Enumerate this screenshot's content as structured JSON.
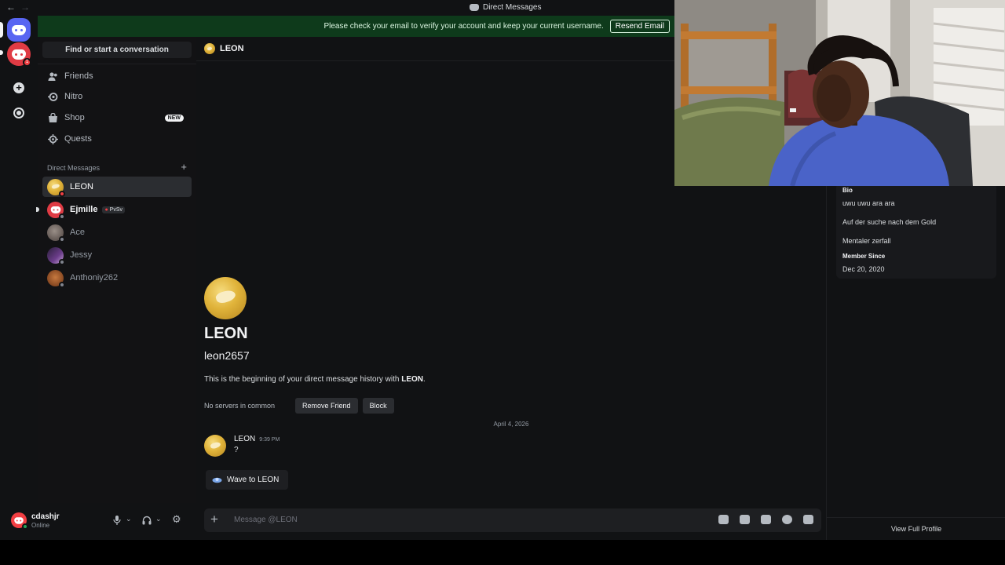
{
  "titlebar": {
    "back": "←",
    "forward": "→",
    "title": "Direct Messages"
  },
  "banner": {
    "text": "Please check your email to verify your account and keep your current username.",
    "button": "Resend Email"
  },
  "sidebar": {
    "search_label": "Find or start a conversation",
    "nav": [
      {
        "label": "Friends",
        "icon": "friends-icon"
      },
      {
        "label": "Nitro",
        "icon": "nitro-icon"
      },
      {
        "label": "Shop",
        "icon": "shop-icon",
        "badge": "NEW"
      },
      {
        "label": "Quests",
        "icon": "quests-icon"
      }
    ],
    "dm_header": "Direct Messages",
    "dm_add": "+",
    "dms": [
      {
        "name": "LEON",
        "status": "dnd",
        "active": true
      },
      {
        "name": "Ejmille",
        "tag": "PvSv",
        "status": "offline",
        "unread": true
      },
      {
        "name": "Ace",
        "status": "offline"
      },
      {
        "name": "Jessy",
        "status": "offline"
      },
      {
        "name": "Anthoniy262",
        "status": "offline"
      }
    ]
  },
  "user_panel": {
    "name": "cdashjr",
    "status": "Online"
  },
  "chat": {
    "header_name": "LEON",
    "intro": {
      "display_name": "LEON",
      "username": "leon2657",
      "text_prefix": "This is the beginning of your direct message history with ",
      "text_name": "LEON",
      "text_suffix": ".",
      "mutual": "No servers in common",
      "remove_friend": "Remove Friend",
      "block": "Block"
    },
    "date_divider": "April 4, 2026",
    "message": {
      "author": "LEON",
      "time": "9:39 PM",
      "content": "?"
    },
    "wave_button": "Wave to LEON",
    "composer_placeholder": "Message @LEON"
  },
  "profile": {
    "bio_label": "Bio",
    "bio_lines": [
      "uwu uwu ara ara",
      "Auf der suche nach dem Gold",
      "Mentaler zerfall"
    ],
    "member_since_label": "Member Since",
    "member_since": "Dec 20, 2020",
    "view_full": "View Full Profile"
  },
  "colors": {
    "accent": "#5865f2",
    "danger": "#f23f43",
    "online": "#23a55a",
    "banner": "#0e3a1b"
  }
}
